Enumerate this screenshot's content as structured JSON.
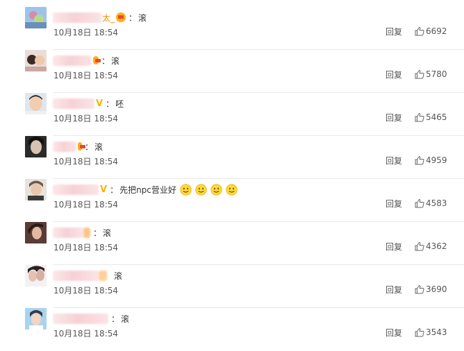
{
  "comments": [
    {
      "text": "滚",
      "name_tail": "太_",
      "badge": "crown",
      "date": "10月18日",
      "time": "18:54",
      "reply": "回复",
      "likes": "6692"
    },
    {
      "text": "滚",
      "name_tail": "",
      "badge": "dot",
      "date": "10月18日",
      "time": "18:54",
      "reply": "回复",
      "likes": "5780"
    },
    {
      "text": "呸",
      "name_tail": "",
      "badge": "v",
      "date": "10月18日",
      "time": "18:54",
      "reply": "回复",
      "likes": "5465"
    },
    {
      "text": "滚",
      "name_tail": "",
      "badge": "dot",
      "date": "10月18日",
      "time": "18:54",
      "reply": "回复",
      "likes": "4959"
    },
    {
      "text": "先把npc营业好",
      "name_tail": "",
      "badge": "v",
      "date": "10月18日",
      "time": "18:54",
      "reply": "回复",
      "likes": "4583",
      "emojis": 4
    },
    {
      "text": "滚",
      "name_tail": "",
      "badge": "dot",
      "date": "10月18日",
      "time": "18:54",
      "reply": "回复",
      "likes": "4362"
    },
    {
      "text": "滚",
      "name_tail": "",
      "badge": "none",
      "date": "10月18日",
      "time": "18:54",
      "reply": "回复",
      "likes": "3690"
    },
    {
      "text": "滚",
      "name_tail": "",
      "badge": "none",
      "date": "10月18日",
      "time": "18:54",
      "reply": "回复",
      "likes": "3543"
    }
  ],
  "colors": {
    "text": "#333333",
    "meta": "#555555",
    "divider": "#e8e8e8",
    "vip_badge": "#f6b500"
  },
  "icons": {
    "like": "thumbs-up-icon",
    "emoji": "smile-emoji-icon"
  }
}
